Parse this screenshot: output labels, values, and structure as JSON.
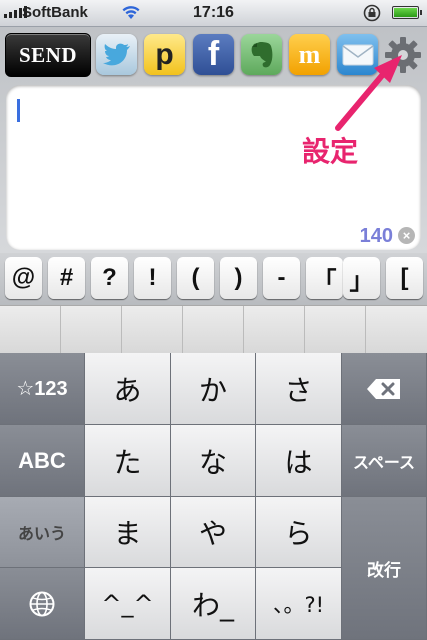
{
  "status_bar": {
    "carrier": "SoftBank",
    "time": "17:16"
  },
  "toolbar": {
    "send_label": "SEND",
    "services": [
      {
        "name": "twitter-icon"
      },
      {
        "name": "p-icon",
        "label": "p"
      },
      {
        "name": "facebook-icon",
        "label": "f"
      },
      {
        "name": "evernote-icon"
      },
      {
        "name": "mixi-icon",
        "label": "m"
      },
      {
        "name": "mail-icon"
      },
      {
        "name": "gear-icon"
      }
    ]
  },
  "compose": {
    "value": "",
    "char_counter": "140"
  },
  "annotation": {
    "text": "設定",
    "color": "#e8246e"
  },
  "symbol_row": [
    "@",
    "#",
    "?",
    "!",
    "(",
    ")",
    "-",
    "「",
    "」",
    "["
  ],
  "keyboard": {
    "left": [
      "☆123",
      "ABC",
      "あいう",
      ""
    ],
    "grid": [
      [
        "あ",
        "か",
        "さ"
      ],
      [
        "た",
        "な",
        "は"
      ],
      [
        "ま",
        "や",
        "ら"
      ],
      [
        "^_^",
        "わ_",
        "、。?!"
      ]
    ],
    "right": {
      "delete": "⌫",
      "space": "スペース",
      "enter": "改行"
    }
  }
}
